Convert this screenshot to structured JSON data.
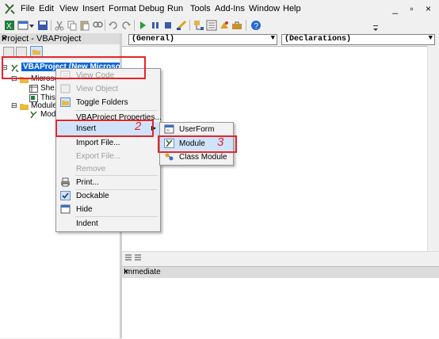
{
  "menubar": {
    "items": [
      "File",
      "Edit",
      "View",
      "Insert",
      "Format",
      "Debug",
      "Run",
      "Tools",
      "Add-Ins",
      "Window",
      "Help"
    ],
    "window_controls": "_ ▫ ×"
  },
  "project_pane": {
    "title": "Project - VBAProject",
    "close": "×",
    "tree": {
      "root": "VBAProject (New Microsoft...",
      "nodes": [
        "Microso...",
        "She...",
        "This...",
        "Module",
        "Mod..."
      ]
    }
  },
  "code_window": {
    "object_combo": "(General)",
    "proc_combo": "(Declarations)"
  },
  "context_menu": {
    "items": [
      {
        "label": "View Code",
        "disabled": true
      },
      {
        "label": "View Object",
        "disabled": true
      },
      {
        "label": "Toggle Folders",
        "disabled": false
      },
      {
        "label": "VBAProject Properties...",
        "disabled": false
      },
      {
        "label": "Insert",
        "disabled": false
      },
      {
        "label": "Import File...",
        "disabled": false
      },
      {
        "label": "Export File...",
        "disabled": true
      },
      {
        "label": "Remove",
        "disabled": true
      },
      {
        "label": "Print...",
        "disabled": false
      },
      {
        "label": "Dockable",
        "disabled": false
      },
      {
        "label": "Hide",
        "disabled": false
      },
      {
        "label": "Indent",
        "disabled": false
      }
    ]
  },
  "submenu": {
    "items": [
      "UserForm",
      "Module",
      "Class Module"
    ]
  },
  "immediate": {
    "title": "Immediate",
    "close": "×"
  },
  "annotations": {
    "step2": "2",
    "step3": "3"
  },
  "colors": {
    "selection_blue": "#0a64d8",
    "menu_highlight": "#cfe3fb",
    "annotation_red": "#e4252b"
  }
}
